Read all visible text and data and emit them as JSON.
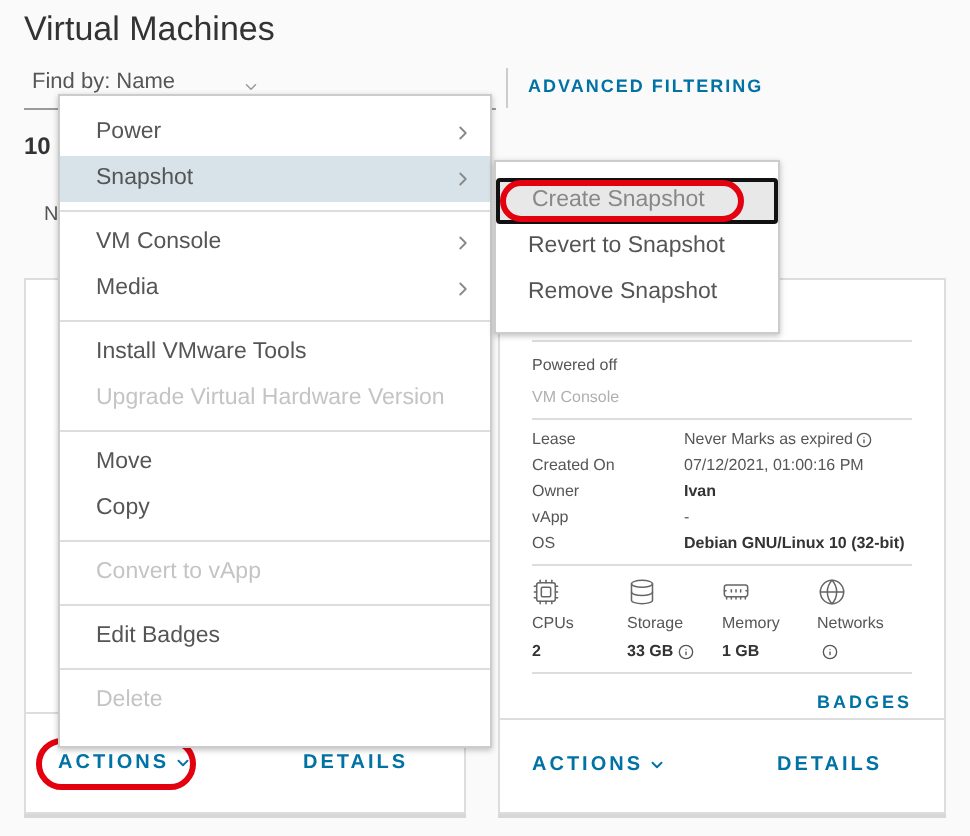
{
  "page_title": "Virtual Machines",
  "filter": {
    "label": "Find by: Name",
    "link": "ADVANCED FILTERING"
  },
  "count_partial": "10",
  "column_partial": "N",
  "cards": [
    {
      "actions": {
        "label": "ACTIONS",
        "annotated": true
      },
      "details": "DETAILS"
    },
    {
      "status": "Powered off",
      "console": "VM Console",
      "fields": [
        {
          "label": "Lease",
          "value": "Never Marks as expired",
          "emphasis": false,
          "info": true
        },
        {
          "label": "Created On",
          "value": "07/12/2021, 01:00:16 PM",
          "emphasis": false,
          "info": false
        },
        {
          "label": "Owner",
          "value": "Ivan",
          "emphasis": true,
          "info": false
        },
        {
          "label": "vApp",
          "value": "-",
          "emphasis": false,
          "info": false
        },
        {
          "label": "OS",
          "value": "Debian GNU/Linux 10 (32-bit)",
          "emphasis": true,
          "info": false
        }
      ],
      "resources": [
        {
          "kind": "cpu",
          "label": "CPUs",
          "value": "2",
          "info": false
        },
        {
          "kind": "storage",
          "label": "Storage",
          "value": "33 GB",
          "info": true
        },
        {
          "kind": "memory",
          "label": "Memory",
          "value": "1 GB",
          "info": false
        },
        {
          "kind": "network",
          "label": "Networks",
          "info": true
        }
      ],
      "badges": "BADGES",
      "actions": {
        "label": "ACTIONS",
        "annotated": false
      },
      "details": "DETAILS"
    }
  ],
  "context_menu": {
    "groups": [
      [
        {
          "label": "Power",
          "submenu": true,
          "selected": false,
          "disabled": false
        },
        {
          "label": "Snapshot",
          "submenu": true,
          "selected": true,
          "disabled": false
        }
      ],
      [
        {
          "label": "VM Console",
          "submenu": true,
          "selected": false,
          "disabled": false
        },
        {
          "label": "Media",
          "submenu": true,
          "selected": false,
          "disabled": false
        }
      ],
      [
        {
          "label": "Install VMware Tools",
          "submenu": false,
          "selected": false,
          "disabled": false
        },
        {
          "label": "Upgrade Virtual Hardware Version",
          "submenu": false,
          "selected": false,
          "disabled": true
        }
      ],
      [
        {
          "label": "Move",
          "submenu": false,
          "selected": false,
          "disabled": false
        },
        {
          "label": "Copy",
          "submenu": false,
          "selected": false,
          "disabled": false
        }
      ],
      [
        {
          "label": "Convert to vApp",
          "submenu": false,
          "selected": false,
          "disabled": true
        }
      ],
      [
        {
          "label": "Edit Badges",
          "submenu": false,
          "selected": false,
          "disabled": false
        }
      ],
      [
        {
          "label": "Delete",
          "submenu": false,
          "selected": false,
          "disabled": true
        }
      ]
    ]
  },
  "submenu": {
    "items": [
      {
        "label": "Create Snapshot",
        "selected": true,
        "annotated": true
      },
      {
        "label": "Revert to Snapshot",
        "selected": false,
        "annotated": false
      },
      {
        "label": "Remove Snapshot",
        "selected": false,
        "annotated": false
      }
    ]
  }
}
